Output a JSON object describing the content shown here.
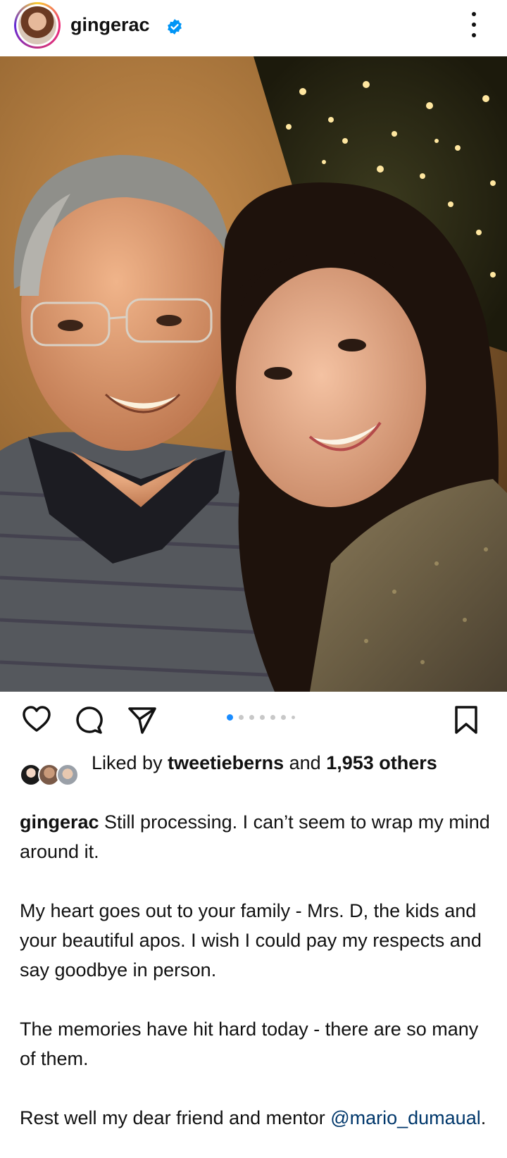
{
  "header": {
    "username": "gingerac",
    "verified": true
  },
  "post": {
    "carousel": {
      "total": 7,
      "current": 1
    }
  },
  "likes": {
    "prefix": "Liked by ",
    "user": "tweetieberns",
    "middle": " and ",
    "count": "1,953",
    "suffix": " others"
  },
  "caption": {
    "author": "gingerac",
    "p1": " Still processing. I can’t seem to wrap my mind around it.",
    "p2": "My heart goes out to your family - Mrs. D, the kids and your beautiful apos. I wish I could pay my respects and say goodbye in person.",
    "p3": "The memories have hit hard today - there are so many of them.",
    "p4": "Rest well my dear friend and mentor ",
    "mention": "@mario_dumaual",
    "p4_end": "."
  },
  "colors": {
    "verified_blue": "#0095f6",
    "active_dot": "#1a8cff",
    "mention": "#00376b"
  },
  "icons": [
    "more-options-icon",
    "heart-icon",
    "comment-icon",
    "share-icon",
    "bookmark-icon",
    "verified-badge-icon"
  ]
}
